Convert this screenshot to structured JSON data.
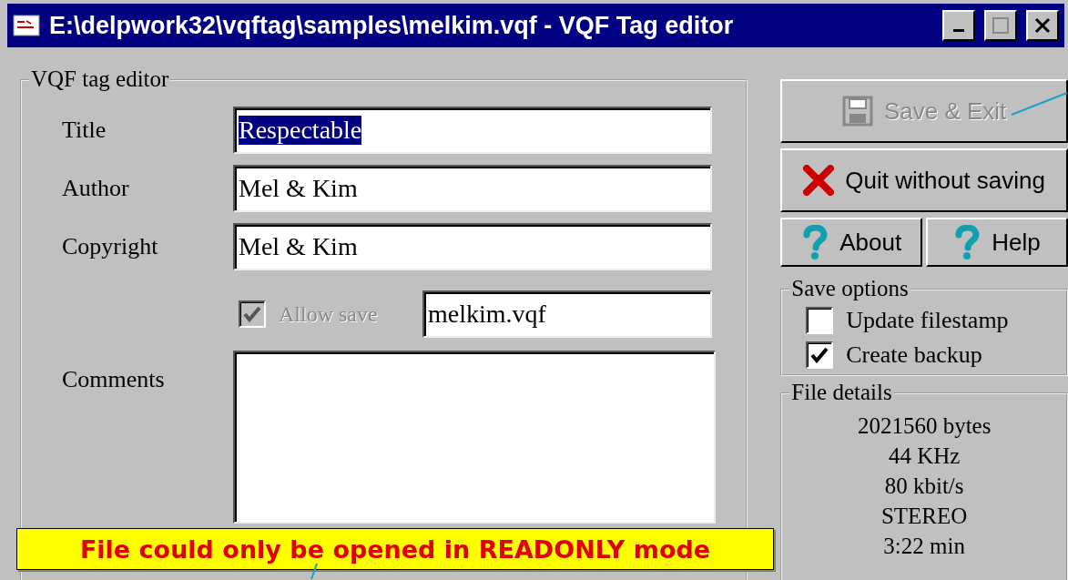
{
  "window": {
    "title": "E:\\delpwork32\\vqftag\\samples\\melkim.vqf - VQF Tag editor"
  },
  "editor": {
    "legend": "VQF tag editor",
    "fields": [
      {
        "label": "Title",
        "value": "Respectable",
        "selected": true
      },
      {
        "label": "Author",
        "value": "Mel & Kim",
        "selected": false
      },
      {
        "label": "Copyright",
        "value": "Mel & Kim",
        "selected": false
      }
    ],
    "allow_save": {
      "label": "Allow save",
      "checked": true,
      "disabled": true
    },
    "filename": "melkim.vqf",
    "comments_label": "Comments"
  },
  "buttons": [
    {
      "label": "Save & Exit",
      "kind": "save",
      "disabled": true
    },
    {
      "label": "Quit without saving",
      "kind": "quit",
      "disabled": false
    },
    {
      "label": "About",
      "kind": "help",
      "disabled": false
    },
    {
      "label": "Help",
      "kind": "help",
      "disabled": false
    }
  ],
  "save_options": {
    "legend": "Save options",
    "options": [
      {
        "label": "Update filestamp",
        "checked": false
      },
      {
        "label": "Create backup",
        "checked": true
      }
    ]
  },
  "file_details": {
    "legend": "File details",
    "lines": [
      "2021560 bytes",
      "44 KHz",
      "80 kbit/s",
      "STEREO",
      "3:22 min"
    ]
  },
  "status_banner": "File could only be opened in READONLY mode"
}
